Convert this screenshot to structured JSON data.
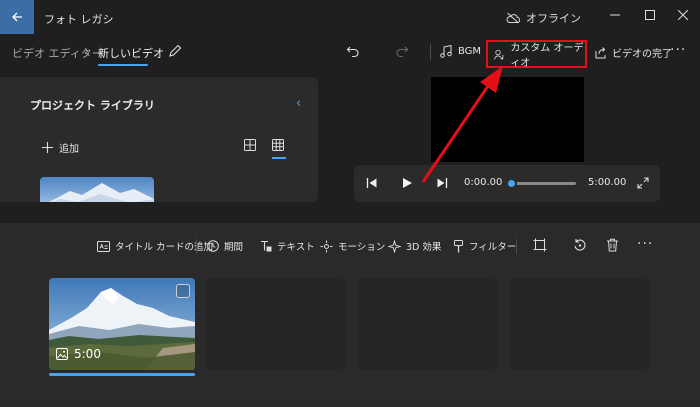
{
  "app": {
    "title": "フォト レガシ"
  },
  "status": {
    "offline_label": "オフライン"
  },
  "breadcrumb": {
    "parent": "ビデオ エディター",
    "separator": "›",
    "current": "新しいビデオ"
  },
  "toolbar": {
    "bgm_label": "BGM",
    "custom_audio_label": "カスタム オーディオ",
    "finish_label": "ビデオの完了",
    "more": "···"
  },
  "library": {
    "title": "プロジェクト ライブラリ",
    "collapse": "‹",
    "add_label": "追加"
  },
  "player": {
    "current_time": "0:00.00",
    "total_time": "5:00.00",
    "progress": 0
  },
  "storyboard": {
    "tools": {
      "title_card": "タイトル カードの追加",
      "duration": "期間",
      "text": "テキスト",
      "motion": "モーション",
      "effects_3d": "3D 効果",
      "filters": "フィルター"
    },
    "more": "···",
    "clips": [
      {
        "duration": "5:00"
      }
    ]
  },
  "colors": {
    "accent": "#4aa3f0",
    "highlight": "#e3101a",
    "titlebar_back": "#3b6ea5"
  }
}
